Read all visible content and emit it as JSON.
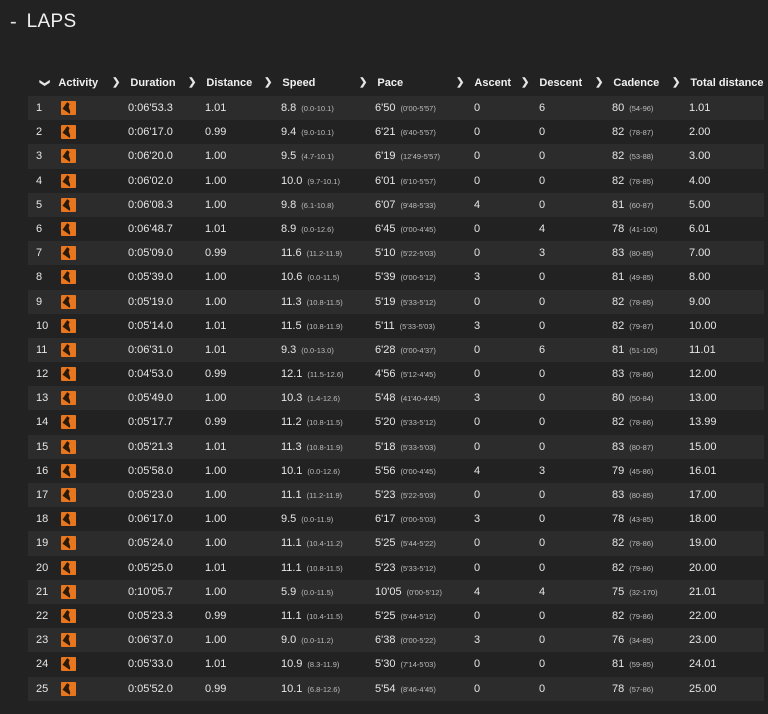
{
  "section": {
    "title": "LAPS",
    "collapse_symbol": "-"
  },
  "columns": {
    "activity": "Activity",
    "duration": "Duration",
    "distance": "Distance",
    "speed": "Speed",
    "pace": "Pace",
    "ascent": "Ascent",
    "descent": "Descent",
    "cadence": "Cadence",
    "total_distance": "Total distance"
  },
  "icons": {
    "activity": "running-shoe-icon",
    "sort": "chevron-right-icon",
    "expand": "chevron-down-icon"
  },
  "colors": {
    "background": "#222222",
    "row_alt": "#2c2c2c",
    "activity_icon": "#e8761f"
  },
  "laps": [
    {
      "num": "1",
      "duration": "0:06'53.3",
      "distance": "1.01",
      "speed": "8.8",
      "speed_range": "(0.0-10.1)",
      "pace": "6'50",
      "pace_range": "(0'00-5'57)",
      "ascent": "0",
      "descent": "6",
      "cadence": "80",
      "cadence_range": "(54-96)",
      "total": "1.01"
    },
    {
      "num": "2",
      "duration": "0:06'17.0",
      "distance": "0.99",
      "speed": "9.4",
      "speed_range": "(9.0-10.1)",
      "pace": "6'21",
      "pace_range": "(6'40-5'57)",
      "ascent": "0",
      "descent": "0",
      "cadence": "82",
      "cadence_range": "(78-87)",
      "total": "2.00"
    },
    {
      "num": "3",
      "duration": "0:06'20.0",
      "distance": "1.00",
      "speed": "9.5",
      "speed_range": "(4.7-10.1)",
      "pace": "6'19",
      "pace_range": "(12'49-5'57)",
      "ascent": "0",
      "descent": "0",
      "cadence": "82",
      "cadence_range": "(53-88)",
      "total": "3.00"
    },
    {
      "num": "4",
      "duration": "0:06'02.0",
      "distance": "1.00",
      "speed": "10.0",
      "speed_range": "(9.7-10.1)",
      "pace": "6'01",
      "pace_range": "(6'10-5'57)",
      "ascent": "0",
      "descent": "0",
      "cadence": "82",
      "cadence_range": "(78-85)",
      "total": "4.00"
    },
    {
      "num": "5",
      "duration": "0:06'08.3",
      "distance": "1.00",
      "speed": "9.8",
      "speed_range": "(6.1-10.8)",
      "pace": "6'07",
      "pace_range": "(9'48-5'33)",
      "ascent": "4",
      "descent": "0",
      "cadence": "81",
      "cadence_range": "(60-87)",
      "total": "5.00"
    },
    {
      "num": "6",
      "duration": "0:06'48.7",
      "distance": "1.01",
      "speed": "8.9",
      "speed_range": "(0.0-12.6)",
      "pace": "6'45",
      "pace_range": "(0'00-4'45)",
      "ascent": "0",
      "descent": "4",
      "cadence": "78",
      "cadence_range": "(41-100)",
      "total": "6.01"
    },
    {
      "num": "7",
      "duration": "0:05'09.0",
      "distance": "0.99",
      "speed": "11.6",
      "speed_range": "(11.2-11.9)",
      "pace": "5'10",
      "pace_range": "(5'22-5'03)",
      "ascent": "0",
      "descent": "3",
      "cadence": "83",
      "cadence_range": "(80-85)",
      "total": "7.00"
    },
    {
      "num": "8",
      "duration": "0:05'39.0",
      "distance": "1.00",
      "speed": "10.6",
      "speed_range": "(0.0-11.5)",
      "pace": "5'39",
      "pace_range": "(0'00-5'12)",
      "ascent": "3",
      "descent": "0",
      "cadence": "81",
      "cadence_range": "(49-85)",
      "total": "8.00"
    },
    {
      "num": "9",
      "duration": "0:05'19.0",
      "distance": "1.00",
      "speed": "11.3",
      "speed_range": "(10.8-11.5)",
      "pace": "5'19",
      "pace_range": "(5'33-5'12)",
      "ascent": "0",
      "descent": "0",
      "cadence": "82",
      "cadence_range": "(78-85)",
      "total": "9.00"
    },
    {
      "num": "10",
      "duration": "0:05'14.0",
      "distance": "1.01",
      "speed": "11.5",
      "speed_range": "(10.8-11.9)",
      "pace": "5'11",
      "pace_range": "(5'33-5'03)",
      "ascent": "3",
      "descent": "0",
      "cadence": "82",
      "cadence_range": "(79-87)",
      "total": "10.00"
    },
    {
      "num": "11",
      "duration": "0:06'31.0",
      "distance": "1.01",
      "speed": "9.3",
      "speed_range": "(0.0-13.0)",
      "pace": "6'28",
      "pace_range": "(0'00-4'37)",
      "ascent": "0",
      "descent": "6",
      "cadence": "81",
      "cadence_range": "(51-105)",
      "total": "11.01"
    },
    {
      "num": "12",
      "duration": "0:04'53.0",
      "distance": "0.99",
      "speed": "12.1",
      "speed_range": "(11.5-12.6)",
      "pace": "4'56",
      "pace_range": "(5'12-4'45)",
      "ascent": "0",
      "descent": "0",
      "cadence": "83",
      "cadence_range": "(78-86)",
      "total": "12.00"
    },
    {
      "num": "13",
      "duration": "0:05'49.0",
      "distance": "1.00",
      "speed": "10.3",
      "speed_range": "(1.4-12.6)",
      "pace": "5'48",
      "pace_range": "(41'40-4'45)",
      "ascent": "3",
      "descent": "0",
      "cadence": "80",
      "cadence_range": "(50-84)",
      "total": "13.00"
    },
    {
      "num": "14",
      "duration": "0:05'17.7",
      "distance": "0.99",
      "speed": "11.2",
      "speed_range": "(10.8-11.5)",
      "pace": "5'20",
      "pace_range": "(5'33-5'12)",
      "ascent": "0",
      "descent": "0",
      "cadence": "82",
      "cadence_range": "(78-86)",
      "total": "13.99"
    },
    {
      "num": "15",
      "duration": "0:05'21.3",
      "distance": "1.01",
      "speed": "11.3",
      "speed_range": "(10.8-11.9)",
      "pace": "5'18",
      "pace_range": "(5'33-5'03)",
      "ascent": "0",
      "descent": "0",
      "cadence": "83",
      "cadence_range": "(80-87)",
      "total": "15.00"
    },
    {
      "num": "16",
      "duration": "0:05'58.0",
      "distance": "1.00",
      "speed": "10.1",
      "speed_range": "(0.0-12.6)",
      "pace": "5'56",
      "pace_range": "(0'00-4'45)",
      "ascent": "4",
      "descent": "3",
      "cadence": "79",
      "cadence_range": "(45-86)",
      "total": "16.01"
    },
    {
      "num": "17",
      "duration": "0:05'23.0",
      "distance": "1.00",
      "speed": "11.1",
      "speed_range": "(11.2-11.9)",
      "pace": "5'23",
      "pace_range": "(5'22-5'03)",
      "ascent": "0",
      "descent": "0",
      "cadence": "83",
      "cadence_range": "(80-85)",
      "total": "17.00"
    },
    {
      "num": "18",
      "duration": "0:06'17.0",
      "distance": "1.00",
      "speed": "9.5",
      "speed_range": "(0.0-11.9)",
      "pace": "6'17",
      "pace_range": "(0'00-5'03)",
      "ascent": "3",
      "descent": "0",
      "cadence": "78",
      "cadence_range": "(43-85)",
      "total": "18.00"
    },
    {
      "num": "19",
      "duration": "0:05'24.0",
      "distance": "1.00",
      "speed": "11.1",
      "speed_range": "(10.4-11.2)",
      "pace": "5'25",
      "pace_range": "(5'44-5'22)",
      "ascent": "0",
      "descent": "0",
      "cadence": "82",
      "cadence_range": "(78-86)",
      "total": "19.00"
    },
    {
      "num": "20",
      "duration": "0:05'25.0",
      "distance": "1.01",
      "speed": "11.1",
      "speed_range": "(10.8-11.5)",
      "pace": "5'23",
      "pace_range": "(5'33-5'12)",
      "ascent": "0",
      "descent": "0",
      "cadence": "82",
      "cadence_range": "(79-86)",
      "total": "20.00"
    },
    {
      "num": "21",
      "duration": "0:10'05.7",
      "distance": "1.00",
      "speed": "5.9",
      "speed_range": "(0.0-11.5)",
      "pace": "10'05",
      "pace_range": "(0'00-5'12)",
      "ascent": "4",
      "descent": "4",
      "cadence": "75",
      "cadence_range": "(32-170)",
      "total": "21.01"
    },
    {
      "num": "22",
      "duration": "0:05'23.3",
      "distance": "0.99",
      "speed": "11.1",
      "speed_range": "(10.4-11.5)",
      "pace": "5'25",
      "pace_range": "(5'44-5'12)",
      "ascent": "0",
      "descent": "0",
      "cadence": "82",
      "cadence_range": "(79-86)",
      "total": "22.00"
    },
    {
      "num": "23",
      "duration": "0:06'37.0",
      "distance": "1.00",
      "speed": "9.0",
      "speed_range": "(0.0-11.2)",
      "pace": "6'38",
      "pace_range": "(0'00-5'22)",
      "ascent": "3",
      "descent": "0",
      "cadence": "76",
      "cadence_range": "(34-85)",
      "total": "23.00"
    },
    {
      "num": "24",
      "duration": "0:05'33.0",
      "distance": "1.01",
      "speed": "10.9",
      "speed_range": "(8.3-11.9)",
      "pace": "5'30",
      "pace_range": "(7'14-5'03)",
      "ascent": "0",
      "descent": "0",
      "cadence": "81",
      "cadence_range": "(59-85)",
      "total": "24.01"
    },
    {
      "num": "25",
      "duration": "0:05'52.0",
      "distance": "0.99",
      "speed": "10.1",
      "speed_range": "(6.8-12.6)",
      "pace": "5'54",
      "pace_range": "(8'46-4'45)",
      "ascent": "0",
      "descent": "0",
      "cadence": "78",
      "cadence_range": "(57-86)",
      "total": "25.00"
    }
  ]
}
